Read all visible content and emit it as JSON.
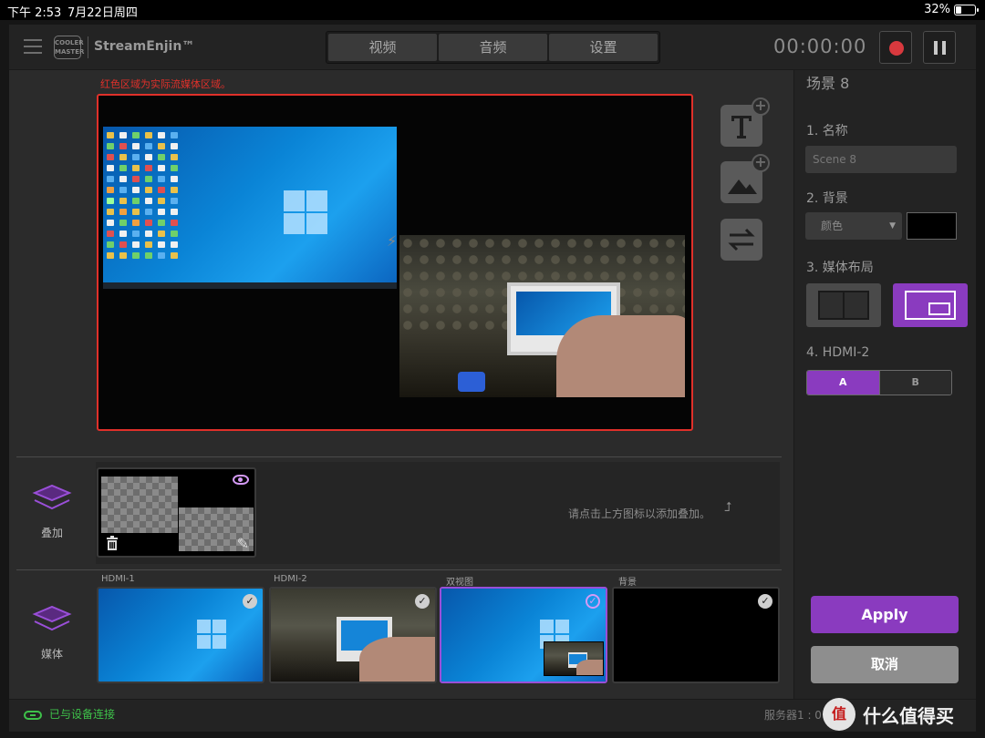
{
  "statusbar": {
    "time": "下午 2:53",
    "date": "7月22日周四",
    "battery": "32%",
    "battery_level": 0.32
  },
  "app": {
    "brand": "StreamEnjin™",
    "logo_text_1": "COOLER",
    "logo_text_2": "MASTER",
    "tabs": [
      "视频",
      "音频",
      "设置"
    ],
    "timer": "00:00:00"
  },
  "preview": {
    "note": "红色区域为实际流媒体区域。",
    "border_color": "#e0302a"
  },
  "overlay": {
    "label": "叠加",
    "hint": "请点击上方图标以添加叠加。"
  },
  "media": {
    "label": "媒体",
    "items": [
      {
        "label": "HDMI-1"
      },
      {
        "label": "HDMI-2"
      },
      {
        "label": "双视图"
      },
      {
        "label": "背景"
      }
    ]
  },
  "scene": {
    "title": "场景 8",
    "name_label": "1. 名称",
    "name_placeholder": "Scene 8",
    "bg_label": "2. 背景",
    "bg_select": "颜色",
    "bg_color": "#000000",
    "layout_label": "3. 媒体布局",
    "hdmi_label": "4. HDMI-2",
    "seg_a": "A",
    "seg_b": "B",
    "apply": "Apply",
    "cancel": "取消"
  },
  "footer": {
    "connection": "已与设备连接",
    "server": "服务器1 : 0 K"
  },
  "watermark": {
    "logo": "值",
    "text": "什么值得买"
  },
  "colors": {
    "accent": "#8a3bbf",
    "connected": "#3ec24a",
    "record": "#d8393e"
  }
}
